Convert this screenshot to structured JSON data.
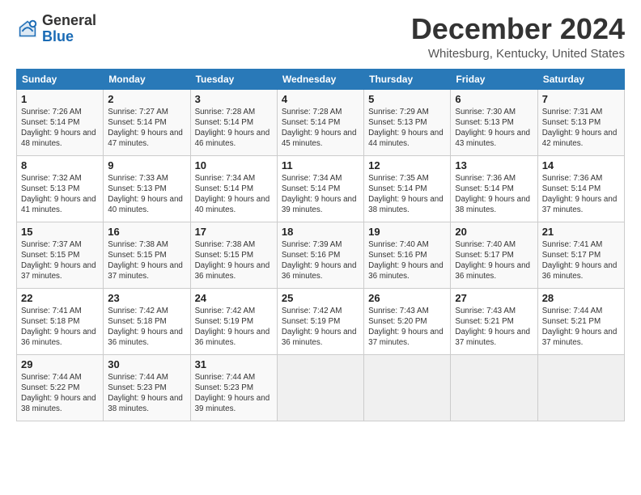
{
  "header": {
    "logo_general": "General",
    "logo_blue": "Blue",
    "title": "December 2024",
    "location": "Whitesburg, Kentucky, United States"
  },
  "calendar": {
    "weekdays": [
      "Sunday",
      "Monday",
      "Tuesday",
      "Wednesday",
      "Thursday",
      "Friday",
      "Saturday"
    ],
    "weeks": [
      [
        {
          "day": "",
          "empty": true
        },
        {
          "day": "",
          "empty": true
        },
        {
          "day": "",
          "empty": true
        },
        {
          "day": "",
          "empty": true
        },
        {
          "day": "",
          "empty": true
        },
        {
          "day": "",
          "empty": true
        },
        {
          "day": "",
          "empty": true
        }
      ],
      [
        {
          "day": "1",
          "sunrise": "Sunrise: 7:26 AM",
          "sunset": "Sunset: 5:14 PM",
          "daylight": "Daylight: 9 hours and 48 minutes."
        },
        {
          "day": "2",
          "sunrise": "Sunrise: 7:27 AM",
          "sunset": "Sunset: 5:14 PM",
          "daylight": "Daylight: 9 hours and 47 minutes."
        },
        {
          "day": "3",
          "sunrise": "Sunrise: 7:28 AM",
          "sunset": "Sunset: 5:14 PM",
          "daylight": "Daylight: 9 hours and 46 minutes."
        },
        {
          "day": "4",
          "sunrise": "Sunrise: 7:28 AM",
          "sunset": "Sunset: 5:14 PM",
          "daylight": "Daylight: 9 hours and 45 minutes."
        },
        {
          "day": "5",
          "sunrise": "Sunrise: 7:29 AM",
          "sunset": "Sunset: 5:13 PM",
          "daylight": "Daylight: 9 hours and 44 minutes."
        },
        {
          "day": "6",
          "sunrise": "Sunrise: 7:30 AM",
          "sunset": "Sunset: 5:13 PM",
          "daylight": "Daylight: 9 hours and 43 minutes."
        },
        {
          "day": "7",
          "sunrise": "Sunrise: 7:31 AM",
          "sunset": "Sunset: 5:13 PM",
          "daylight": "Daylight: 9 hours and 42 minutes."
        }
      ],
      [
        {
          "day": "8",
          "sunrise": "Sunrise: 7:32 AM",
          "sunset": "Sunset: 5:13 PM",
          "daylight": "Daylight: 9 hours and 41 minutes."
        },
        {
          "day": "9",
          "sunrise": "Sunrise: 7:33 AM",
          "sunset": "Sunset: 5:13 PM",
          "daylight": "Daylight: 9 hours and 40 minutes."
        },
        {
          "day": "10",
          "sunrise": "Sunrise: 7:34 AM",
          "sunset": "Sunset: 5:14 PM",
          "daylight": "Daylight: 9 hours and 40 minutes."
        },
        {
          "day": "11",
          "sunrise": "Sunrise: 7:34 AM",
          "sunset": "Sunset: 5:14 PM",
          "daylight": "Daylight: 9 hours and 39 minutes."
        },
        {
          "day": "12",
          "sunrise": "Sunrise: 7:35 AM",
          "sunset": "Sunset: 5:14 PM",
          "daylight": "Daylight: 9 hours and 38 minutes."
        },
        {
          "day": "13",
          "sunrise": "Sunrise: 7:36 AM",
          "sunset": "Sunset: 5:14 PM",
          "daylight": "Daylight: 9 hours and 38 minutes."
        },
        {
          "day": "14",
          "sunrise": "Sunrise: 7:36 AM",
          "sunset": "Sunset: 5:14 PM",
          "daylight": "Daylight: 9 hours and 37 minutes."
        }
      ],
      [
        {
          "day": "15",
          "sunrise": "Sunrise: 7:37 AM",
          "sunset": "Sunset: 5:15 PM",
          "daylight": "Daylight: 9 hours and 37 minutes."
        },
        {
          "day": "16",
          "sunrise": "Sunrise: 7:38 AM",
          "sunset": "Sunset: 5:15 PM",
          "daylight": "Daylight: 9 hours and 37 minutes."
        },
        {
          "day": "17",
          "sunrise": "Sunrise: 7:38 AM",
          "sunset": "Sunset: 5:15 PM",
          "daylight": "Daylight: 9 hours and 36 minutes."
        },
        {
          "day": "18",
          "sunrise": "Sunrise: 7:39 AM",
          "sunset": "Sunset: 5:16 PM",
          "daylight": "Daylight: 9 hours and 36 minutes."
        },
        {
          "day": "19",
          "sunrise": "Sunrise: 7:40 AM",
          "sunset": "Sunset: 5:16 PM",
          "daylight": "Daylight: 9 hours and 36 minutes."
        },
        {
          "day": "20",
          "sunrise": "Sunrise: 7:40 AM",
          "sunset": "Sunset: 5:17 PM",
          "daylight": "Daylight: 9 hours and 36 minutes."
        },
        {
          "day": "21",
          "sunrise": "Sunrise: 7:41 AM",
          "sunset": "Sunset: 5:17 PM",
          "daylight": "Daylight: 9 hours and 36 minutes."
        }
      ],
      [
        {
          "day": "22",
          "sunrise": "Sunrise: 7:41 AM",
          "sunset": "Sunset: 5:18 PM",
          "daylight": "Daylight: 9 hours and 36 minutes."
        },
        {
          "day": "23",
          "sunrise": "Sunrise: 7:42 AM",
          "sunset": "Sunset: 5:18 PM",
          "daylight": "Daylight: 9 hours and 36 minutes."
        },
        {
          "day": "24",
          "sunrise": "Sunrise: 7:42 AM",
          "sunset": "Sunset: 5:19 PM",
          "daylight": "Daylight: 9 hours and 36 minutes."
        },
        {
          "day": "25",
          "sunrise": "Sunrise: 7:42 AM",
          "sunset": "Sunset: 5:19 PM",
          "daylight": "Daylight: 9 hours and 36 minutes."
        },
        {
          "day": "26",
          "sunrise": "Sunrise: 7:43 AM",
          "sunset": "Sunset: 5:20 PM",
          "daylight": "Daylight: 9 hours and 37 minutes."
        },
        {
          "day": "27",
          "sunrise": "Sunrise: 7:43 AM",
          "sunset": "Sunset: 5:21 PM",
          "daylight": "Daylight: 9 hours and 37 minutes."
        },
        {
          "day": "28",
          "sunrise": "Sunrise: 7:44 AM",
          "sunset": "Sunset: 5:21 PM",
          "daylight": "Daylight: 9 hours and 37 minutes."
        }
      ],
      [
        {
          "day": "29",
          "sunrise": "Sunrise: 7:44 AM",
          "sunset": "Sunset: 5:22 PM",
          "daylight": "Daylight: 9 hours and 38 minutes."
        },
        {
          "day": "30",
          "sunrise": "Sunrise: 7:44 AM",
          "sunset": "Sunset: 5:23 PM",
          "daylight": "Daylight: 9 hours and 38 minutes."
        },
        {
          "day": "31",
          "sunrise": "Sunrise: 7:44 AM",
          "sunset": "Sunset: 5:23 PM",
          "daylight": "Daylight: 9 hours and 39 minutes."
        },
        {
          "day": "",
          "empty": true
        },
        {
          "day": "",
          "empty": true
        },
        {
          "day": "",
          "empty": true
        },
        {
          "day": "",
          "empty": true
        }
      ]
    ]
  }
}
